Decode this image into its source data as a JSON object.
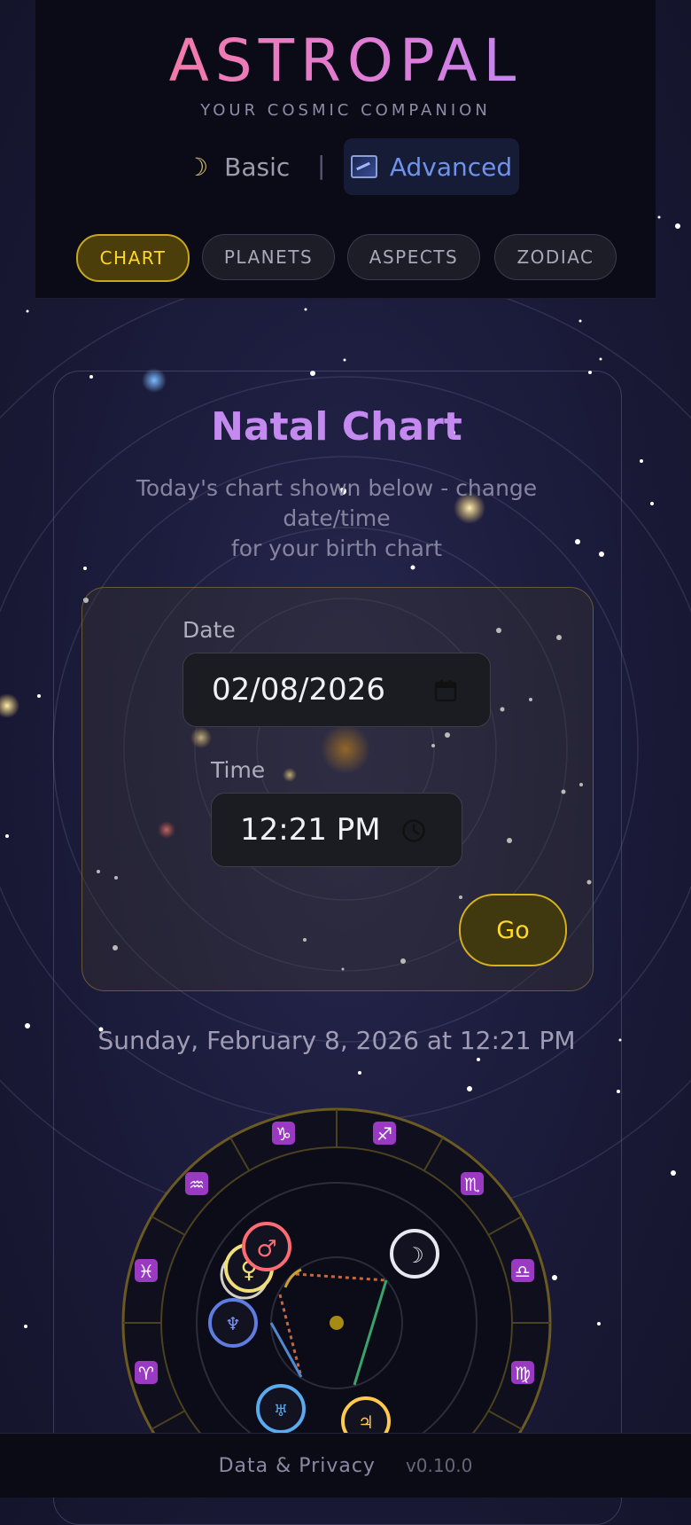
{
  "app": {
    "title": "ASTROPAL",
    "tagline": "YOUR COSMIC COMPANION"
  },
  "modes": {
    "basic": {
      "label": "Basic",
      "icon": "crescent-moon-icon"
    },
    "separator": "|",
    "advanced": {
      "label": "Advanced",
      "icon": "galaxy-icon",
      "selected": true
    }
  },
  "tabs": [
    {
      "label": "CHART",
      "active": true
    },
    {
      "label": "PLANETS",
      "active": false
    },
    {
      "label": "ASPECTS",
      "active": false
    },
    {
      "label": "ZODIAC",
      "active": false
    }
  ],
  "natal": {
    "title": "Natal Chart",
    "subtitle_line1": "Today's chart shown below - change date/time",
    "subtitle_line2": "for your birth chart",
    "date_label": "Date",
    "date_value": "02/08/2026",
    "time_label": "Time",
    "time_value": "12:21 PM",
    "go_label": "Go",
    "datetime_display": "Sunday, February 8, 2026 at 12:21 PM"
  },
  "wheel": {
    "signs": [
      "♑",
      "♐",
      "♏",
      "♎",
      "♍",
      "♒",
      "♓",
      "♈"
    ],
    "planets": [
      "♂",
      "♀",
      "☽",
      "♆",
      "♅",
      "♃"
    ],
    "colors": {
      "ring": "#6a5a22",
      "mars": "#ff6b72",
      "venus": "#f1dd7a",
      "moon": "#e8e8f0",
      "neptune": "#5f7de0",
      "uranus": "#5aaaf0",
      "jupiter": "#ffc94d"
    }
  },
  "footer": {
    "link": "Data & Privacy",
    "version": "v0.10.0"
  },
  "colors": {
    "accent_gold": "#ffd72a",
    "accent_purple": "#c48af0",
    "accent_blue": "#6f93ec"
  }
}
